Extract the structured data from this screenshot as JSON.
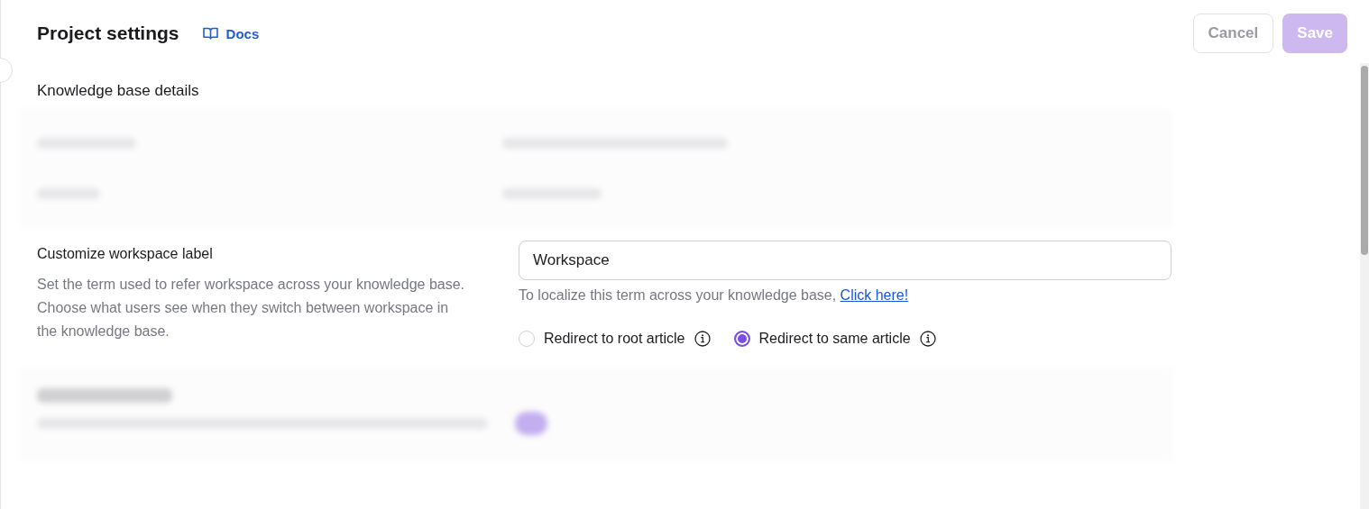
{
  "header": {
    "title": "Project settings",
    "docs_link": "Docs"
  },
  "buttons": [
    {
      "label": "Cancel",
      "kind": "secondary",
      "disabled": true
    },
    {
      "label": "Save",
      "kind": "primary",
      "disabled": true
    }
  ],
  "section_title": "Knowledge base details",
  "workspace_label": {
    "title": "Customize workspace label",
    "description": "Set the term used to refer workspace across your knowledge base. Choose what users see when they switch between workspace in the knowledge base.",
    "value": "Workspace",
    "hint": "To localize this term across your knowledge base,",
    "hint_link": "Click here!",
    "options": [
      {
        "label": "Redirect to root article",
        "selected": false
      },
      {
        "label": "Redirect to same article",
        "selected": true
      }
    ]
  }
}
